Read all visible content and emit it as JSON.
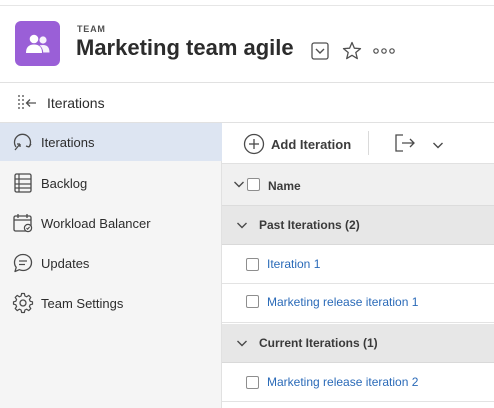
{
  "header": {
    "kicker": "TEAM",
    "title": "Marketing team agile",
    "icons": [
      "team-icon",
      "dropdown-icon",
      "star-icon",
      "more-icon"
    ],
    "avatar_color": "#9a5fd7"
  },
  "subheader": {
    "title": "Iterations",
    "icon": "collapse-panel-icon"
  },
  "sidebar": {
    "items": [
      {
        "label": "Iterations",
        "icon": "iterations-icon",
        "active": true
      },
      {
        "label": "Backlog",
        "icon": "backlog-icon",
        "active": false
      },
      {
        "label": "Workload Balancer",
        "icon": "workload-balancer-icon",
        "active": false
      },
      {
        "label": "Updates",
        "icon": "updates-icon",
        "active": false
      },
      {
        "label": "Team Settings",
        "icon": "gear-icon",
        "active": false
      }
    ],
    "active_color": "#dde5f2"
  },
  "toolbar": {
    "add_label": "Add Iteration",
    "icons": [
      "add-icon",
      "export-icon",
      "chevron-down-icon"
    ]
  },
  "table": {
    "column_header": "Name",
    "groups": [
      {
        "label": "Past Iterations (2)",
        "items": [
          "Iteration 1",
          "Marketing release iteration 1"
        ]
      },
      {
        "label": "Current Iterations (1)",
        "items": [
          "Marketing release iteration 2"
        ]
      }
    ],
    "link_color": "#2a6ab8"
  }
}
